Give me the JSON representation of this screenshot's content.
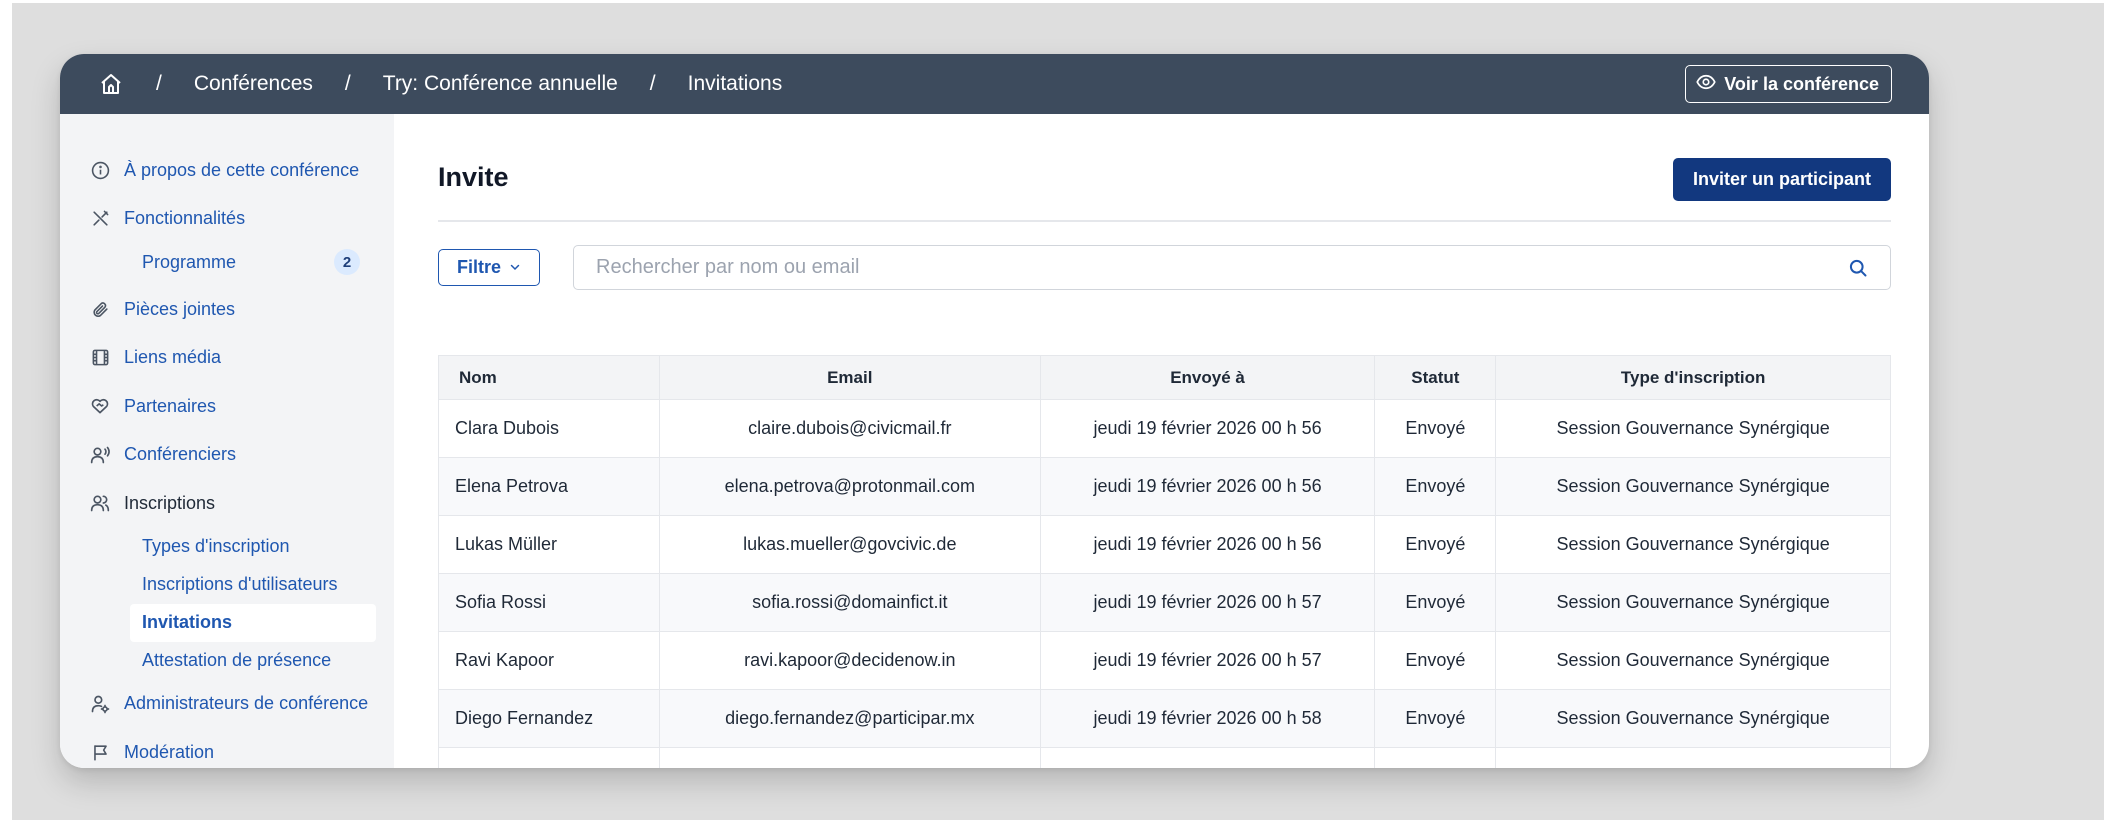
{
  "breadcrumb": {
    "home_icon": "home-icon",
    "items": [
      "Conférences",
      "Try: Conférence annuelle",
      "Invitations"
    ],
    "separator": "/"
  },
  "header": {
    "view_button_label": "Voir la conférence",
    "view_icon": "eye-icon"
  },
  "sidebar": {
    "items": [
      {
        "label": "À propos de cette conférence",
        "icon": "info-icon"
      },
      {
        "label": "Fonctionnalités",
        "icon": "tools-icon"
      },
      {
        "label": "Programme",
        "badge": "2"
      },
      {
        "label": "Pièces jointes",
        "icon": "paperclip-icon"
      },
      {
        "label": "Liens média",
        "icon": "film-icon"
      },
      {
        "label": "Partenaires",
        "icon": "handshake-heart-icon"
      },
      {
        "label": "Conférenciers",
        "icon": "speaker-icon"
      },
      {
        "label": "Inscriptions",
        "icon": "users-icon"
      },
      {
        "label": "Types d'inscription"
      },
      {
        "label": "Inscriptions d'utilisateurs"
      },
      {
        "label": "Invitations",
        "active": true
      },
      {
        "label": "Attestation de présence"
      },
      {
        "label": "Administrateurs de conférence",
        "icon": "admin-user-icon"
      },
      {
        "label": "Modération",
        "icon": "flag-icon"
      }
    ]
  },
  "main": {
    "title": "Invite",
    "invite_button_label": "Inviter un participant",
    "filter_label": "Filtre",
    "search_placeholder": "Rechercher par nom ou email",
    "search_value": ""
  },
  "table": {
    "headers": [
      "Nom",
      "Email",
      "Envoyé à",
      "Statut",
      "Type d'inscription"
    ],
    "rows": [
      [
        "Clara Dubois",
        "claire.dubois@civicmail.fr",
        "jeudi 19 février 2026 00 h 56",
        "Envoyé",
        "Session Gouvernance Synérgique"
      ],
      [
        "Elena Petrova",
        "elena.petrova@protonmail.com",
        "jeudi 19 février 2026 00 h 56",
        "Envoyé",
        "Session Gouvernance Synérgique"
      ],
      [
        "Lukas Müller",
        "lukas.mueller@govcivic.de",
        "jeudi 19 février 2026 00 h 56",
        "Envoyé",
        "Session Gouvernance Synérgique"
      ],
      [
        "Sofia Rossi",
        "sofia.rossi@domainfict.it",
        "jeudi 19 février 2026 00 h 57",
        "Envoyé",
        "Session Gouvernance Synérgique"
      ],
      [
        "Ravi Kapoor",
        "ravi.kapoor@decidenow.in",
        "jeudi 19 février 2026 00 h 57",
        "Envoyé",
        "Session Gouvernance Synérgique"
      ],
      [
        "Diego Fernandez",
        "diego.fernandez@participar.mx",
        "jeudi 19 février 2026 00 h 58",
        "Envoyé",
        "Session Gouvernance Synérgique"
      ]
    ]
  },
  "colors": {
    "topbar": "#3d4b5d",
    "primary_button": "#12387f",
    "link": "#1f57b0",
    "sidebar_bg": "#f3f4f6"
  }
}
